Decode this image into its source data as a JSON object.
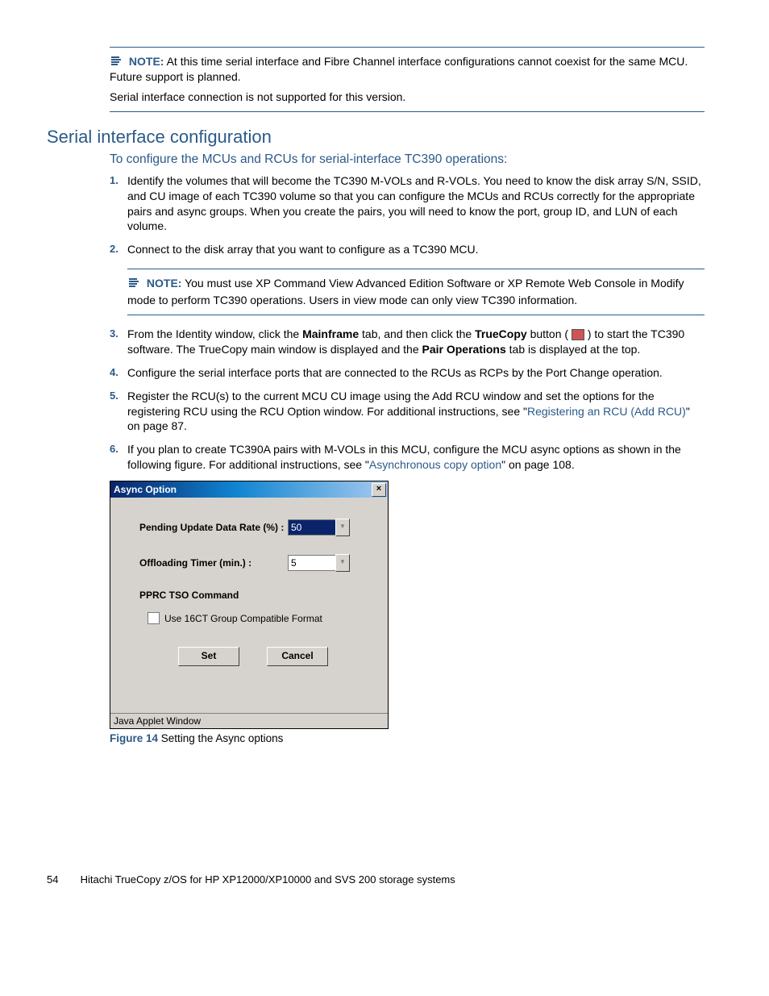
{
  "note1": {
    "label": "NOTE:",
    "text1": "At this time serial interface and Fibre Channel interface configurations cannot coexist for the same MCU. Future support is planned.",
    "text2": "Serial interface connection is not supported for this version."
  },
  "heading": "Serial interface configuration",
  "subheading": "To configure the MCUs and RCUs for serial-interface TC390 operations:",
  "steps": {
    "s1": {
      "n": "1.",
      "t": "Identify the volumes that will become the TC390 M-VOLs and R-VOLs. You need to know the disk array S/N, SSID, and CU image of each TC390 volume so that you can configure the MCUs and RCUs correctly for the appropriate pairs and async groups. When you create the pairs, you will need to know the port, group ID, and LUN of each volume."
    },
    "s2": {
      "n": "2.",
      "t": "Connect to the disk array that you want to configure as a TC390 MCU."
    },
    "note2": {
      "label": "NOTE:",
      "t": "You must use XP Command View Advanced Edition Software or XP Remote Web Console in Modify mode to perform TC390 operations. Users in view mode can only view TC390 information."
    },
    "s3": {
      "n": "3.",
      "a": "From the Identity window, click the ",
      "b": "Mainframe",
      "c": " tab, and then click the ",
      "d": "TrueCopy",
      "e": " button ( ",
      "f": " ) to start the TC390 software. The TrueCopy main window is displayed and the ",
      "g": "Pair Operations",
      "h": " tab is displayed at the top."
    },
    "s4": {
      "n": "4.",
      "t": "Configure the serial interface ports that are connected to the RCUs as RCPs by the Port Change operation."
    },
    "s5": {
      "n": "5.",
      "a": "Register the RCU(s) to the current MCU CU image using the Add RCU window and set the options for the registering RCU using the RCU Option window. For additional instructions, see \"",
      "link": "Registering an RCU (Add RCU)",
      "b": "\" on page 87."
    },
    "s6": {
      "n": "6.",
      "a": "If you plan to create TC390A pairs with M-VOLs in this MCU, configure the MCU async options as shown in the following figure. For additional instructions, see \"",
      "link": "Asynchronous copy option",
      "b": "\" on page 108."
    }
  },
  "dialog": {
    "title": "Async Option",
    "close": "×",
    "row1_label": "Pending Update Data Rate (%) :",
    "row1_value": "50",
    "row2_label": "Offloading Timer (min.) :",
    "row2_value": "5",
    "section": "PPRC TSO Command",
    "check_label": "Use 16CT Group Compatible Format",
    "btn_set": "Set",
    "btn_cancel": "Cancel",
    "status": "Java Applet Window"
  },
  "figure": {
    "label": "Figure 14",
    "caption": " Setting the Async options"
  },
  "footer": {
    "page": "54",
    "text": "Hitachi TrueCopy z/OS for HP XP12000/XP10000 and SVS 200 storage systems"
  }
}
